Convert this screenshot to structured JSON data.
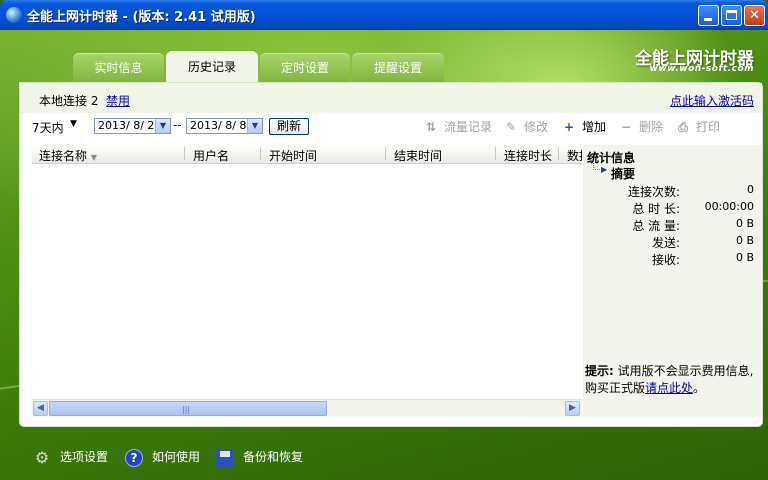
{
  "window": {
    "title": "全能上网计时器 - (版本: 2.41 试用版)"
  },
  "brand": {
    "name": "全能上网计时器",
    "url": "www.won-soft.com"
  },
  "tabs": [
    {
      "label": "实时信息",
      "active": false
    },
    {
      "label": "历史记录",
      "active": true
    },
    {
      "label": "定时设置",
      "active": false
    },
    {
      "label": "提醒设置",
      "active": false
    }
  ],
  "connection": {
    "label": "本地连接 2",
    "disable_link": "禁用",
    "activation_link": "点此输入激活码"
  },
  "filter": {
    "range": "7天内",
    "date_from": "2013/ 8/ 2",
    "date_to": "2013/ 8/ 8",
    "refresh_label": "刷新"
  },
  "toolbar": [
    {
      "label": "流量记录",
      "icon": "traffic-icon",
      "enabled": false
    },
    {
      "label": "修改",
      "icon": "pencil-icon",
      "enabled": false
    },
    {
      "label": "增加",
      "icon": "plus-icon",
      "enabled": true
    },
    {
      "label": "删除",
      "icon": "minus-icon",
      "enabled": false
    },
    {
      "label": "打印",
      "icon": "printer-icon",
      "enabled": false
    }
  ],
  "table": {
    "columns": [
      "连接名称",
      "用户名",
      "开始时间",
      "结束时间",
      "连接时长",
      "数据"
    ],
    "rows": []
  },
  "stats": {
    "title": "统计信息",
    "summary_label": "摘要",
    "rows": [
      {
        "label": "连接次数:",
        "value": "0"
      },
      {
        "label": "总 时 长:",
        "value": "00:00:00"
      },
      {
        "label": "总 流 量:",
        "value": "0 B"
      },
      {
        "label": "发送:",
        "value": "0 B"
      },
      {
        "label": "接收:",
        "value": "0 B"
      }
    ],
    "hint_prefix": "提示:",
    "hint_text": "试用版不会显示费用信息,购买正式版",
    "hint_link": "请点此处",
    "hint_suffix": "。"
  },
  "bottom": [
    {
      "label": "选项设置",
      "icon": "gear-icon"
    },
    {
      "label": "如何使用",
      "icon": "help-icon"
    },
    {
      "label": "备份和恢复",
      "icon": "floppy-icon"
    }
  ]
}
